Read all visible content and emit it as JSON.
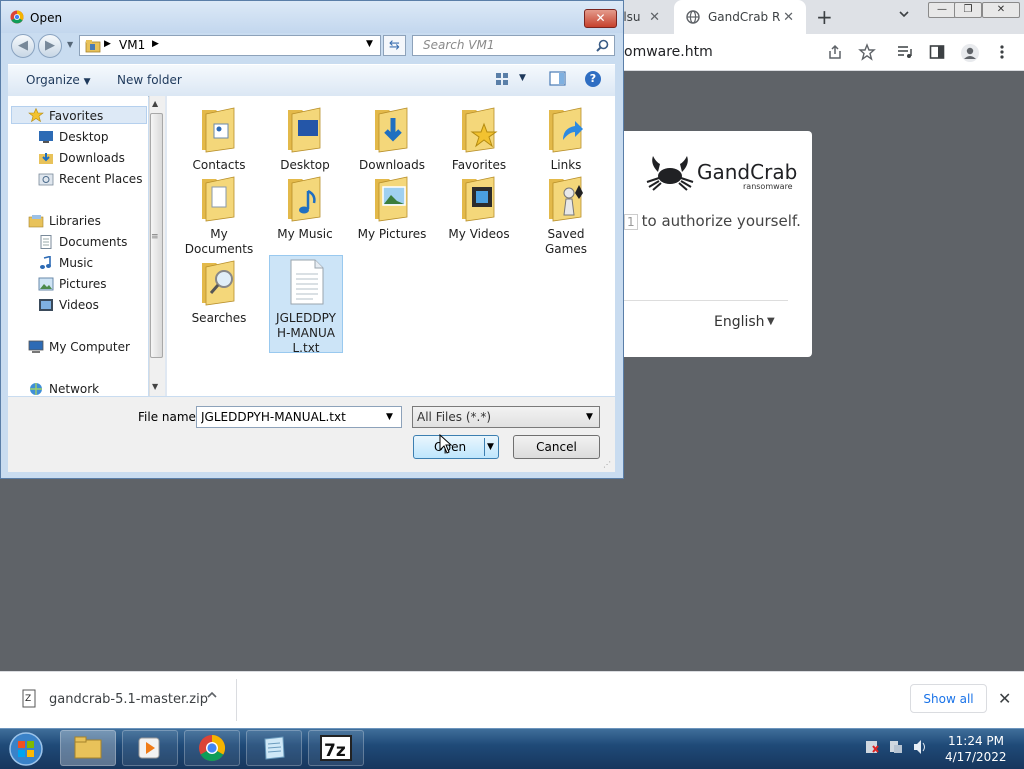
{
  "browser": {
    "tabs": [
      {
        "label": "ilsu"
      },
      {
        "label": "GandCrab Ra"
      }
    ],
    "new_tab_label": "+",
    "address": "omware.htm",
    "window_controls": [
      "minimize",
      "restore",
      "close"
    ]
  },
  "page": {
    "logo_text": "GandCrab",
    "logo_subtext": "ransomware",
    "auth_key": "1",
    "auth_text": "to authorize yourself.",
    "language": "English"
  },
  "dialog": {
    "title": "Open",
    "breadcrumb": "VM1",
    "search_placeholder": "Search VM1",
    "organize_label": "Organize",
    "new_folder_label": "New folder",
    "nav_pane": {
      "favorites": {
        "label": "Favorites",
        "items": [
          "Desktop",
          "Downloads",
          "Recent Places"
        ]
      },
      "libraries": {
        "label": "Libraries",
        "items": [
          "Documents",
          "Music",
          "Pictures",
          "Videos"
        ]
      },
      "computer": "My Computer",
      "network": "Network"
    },
    "files": [
      {
        "label": "Contacts",
        "icon": "contacts-folder-icon"
      },
      {
        "label": "Desktop",
        "icon": "desktop-folder-icon"
      },
      {
        "label": "Downloads",
        "icon": "downloads-folder-icon"
      },
      {
        "label": "Favorites",
        "icon": "favorites-folder-icon"
      },
      {
        "label": "Links",
        "icon": "links-folder-icon"
      },
      {
        "label": "My Documents",
        "icon": "documents-folder-icon"
      },
      {
        "label": "My Music",
        "icon": "music-folder-icon"
      },
      {
        "label": "My Pictures",
        "icon": "pictures-folder-icon"
      },
      {
        "label": "My Videos",
        "icon": "videos-folder-icon"
      },
      {
        "label": "Saved Games",
        "icon": "games-folder-icon"
      },
      {
        "label": "Searches",
        "icon": "searches-folder-icon"
      },
      {
        "label": "JGLEDDPYH-MANUAL.txt",
        "icon": "text-file-icon",
        "selected": true
      }
    ],
    "file_name_label": "File name:",
    "file_name_value": "JGLEDDPYH-MANUAL.txt",
    "file_type": "All Files (*.*)",
    "open_label": "Open",
    "cancel_label": "Cancel"
  },
  "downloads_bar": {
    "file": "gandcrab-5.1-master.zip",
    "show_all": "Show all"
  },
  "taskbar": {
    "apps": [
      "windows-explorer",
      "media-player",
      "chrome",
      "notepad",
      "7-zip"
    ],
    "time": "11:24 PM",
    "date": "4/17/2022"
  },
  "colors": {
    "dialog_frame": "#c9dcf0",
    "selection": "#cce4f7",
    "page_bg": "#5f6368",
    "link_blue": "#1a73e8",
    "taskbar": "#1f4a78"
  }
}
